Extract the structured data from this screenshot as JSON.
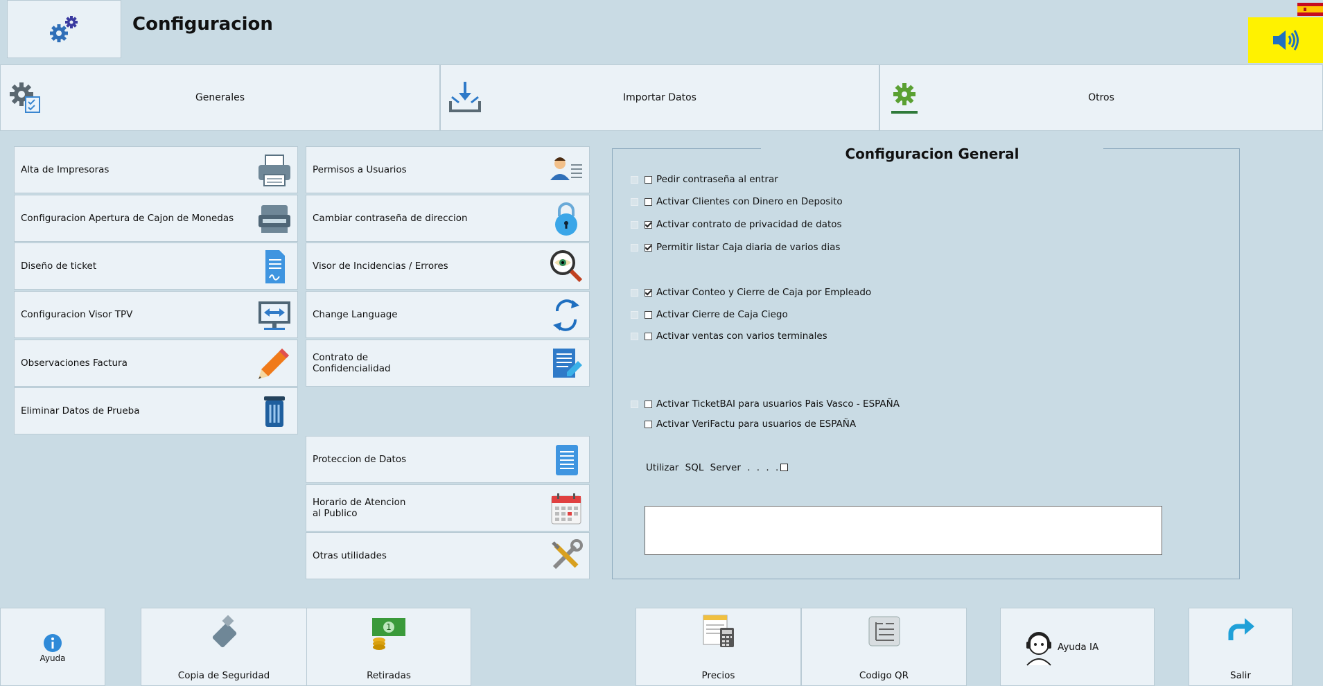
{
  "header": {
    "title": "Configuracion"
  },
  "tabs": [
    {
      "label": "Generales"
    },
    {
      "label": "Importar Datos"
    },
    {
      "label": "Otros"
    }
  ],
  "left_menu": [
    {
      "label": "Alta de Impresoras",
      "icon": "printer-icon"
    },
    {
      "label": "Configuracion Apertura de Cajon de Monedas",
      "icon": "cash-drawer-icon"
    },
    {
      "label": "Diseño de ticket",
      "icon": "ticket-document-icon"
    },
    {
      "label": "Configuracion Visor TPV",
      "icon": "monitor-icon"
    },
    {
      "label": "Observaciones Factura",
      "icon": "pencil-icon"
    },
    {
      "label": "Eliminar Datos de Prueba",
      "icon": "trash-icon"
    }
  ],
  "mid_menu": [
    {
      "label": "Permisos a Usuarios",
      "icon": "user-permissions-icon"
    },
    {
      "label": "Cambiar contraseña de direccion",
      "icon": "lock-icon"
    },
    {
      "label": "Visor de Incidencias / Errores",
      "icon": "magnifier-eye-icon"
    },
    {
      "label": "Change Language",
      "icon": "refresh-arrows-icon"
    },
    {
      "label": "Contrato de\nConfidencialidad",
      "icon": "contract-edit-icon"
    }
  ],
  "mid_menu2": [
    {
      "label": "Proteccion de Datos",
      "icon": "data-document-icon"
    },
    {
      "label": "Horario de Atencion\nal Publico",
      "icon": "calendar-icon"
    },
    {
      "label": "Otras utilidades",
      "icon": "tools-icon"
    }
  ],
  "panel": {
    "title": "Configuracion General",
    "options": [
      {
        "label": "Pedir contraseña al entrar",
        "checked": false
      },
      {
        "label": "Activar Clientes con Dinero en Deposito",
        "checked": false
      },
      {
        "label": "Activar contrato de privacidad de datos",
        "checked": true
      },
      {
        "label": "Permitir listar Caja diaria de varios dias",
        "checked": true
      },
      {
        "label": "Activar Conteo y Cierre de Caja por Empleado",
        "checked": true
      },
      {
        "label": "Activar Cierre de Caja Ciego",
        "checked": false
      },
      {
        "label": "Activar ventas con varios terminales",
        "checked": false
      },
      {
        "label": "Activar TicketBAI para usuarios Pais Vasco - ESPAÑA",
        "checked": false
      },
      {
        "label": "Activar VeriFactu para usuarios de ESPAÑA",
        "checked": false
      }
    ],
    "sql_label": "Utilizar SQL Server . . . ."
  },
  "bottom": [
    {
      "label": "Ayuda"
    },
    {
      "label": "Copia de Seguridad"
    },
    {
      "label": "Retiradas"
    },
    {
      "label": "Precios"
    },
    {
      "label": "Codigo QR"
    },
    {
      "label": "Ayuda IA"
    },
    {
      "label": "Salir"
    }
  ],
  "colors": {
    "accent_yellow": "#fff200",
    "background": "#c9dbe4",
    "button": "#ebf2f7"
  }
}
